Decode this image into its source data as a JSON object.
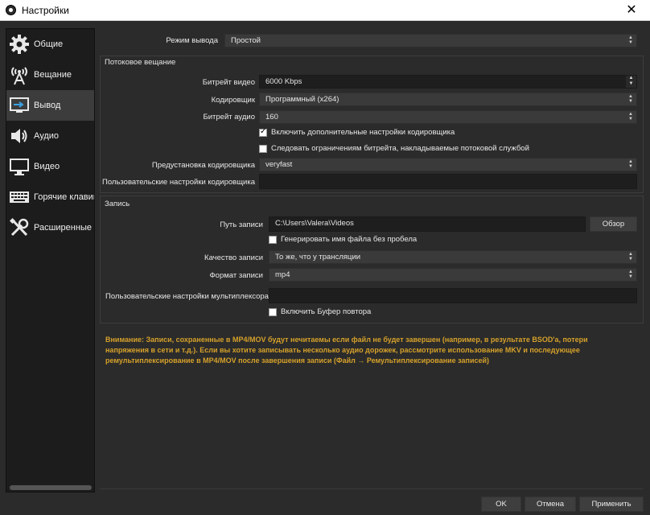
{
  "window": {
    "title": "Настройки",
    "close_glyph": "✕"
  },
  "sidebar": {
    "items": [
      {
        "label": "Общие",
        "icon": "gear-icon"
      },
      {
        "label": "Вещание",
        "icon": "broadcast-antenna-icon"
      },
      {
        "label": "Вывод",
        "icon": "output-monitor-icon",
        "active": true
      },
      {
        "label": "Аудио",
        "icon": "speaker-icon"
      },
      {
        "label": "Видео",
        "icon": "monitor-icon"
      },
      {
        "label": "Горячие клавиши",
        "icon": "keyboard-icon"
      },
      {
        "label": "Расширенные",
        "icon": "tools-icon"
      }
    ]
  },
  "output_mode": {
    "label": "Режим вывода",
    "value": "Простой"
  },
  "streaming": {
    "title": "Потоковое вещание",
    "video_bitrate_label": "Битрейт видео",
    "video_bitrate_value": "6000 Kbps",
    "encoder_label": "Кодировщик",
    "encoder_value": "Программный (x264)",
    "audio_bitrate_label": "Битрейт аудио",
    "audio_bitrate_value": "160",
    "advanced_encoder_checkbox": "Включить дополнительные настройки кодировщика",
    "advanced_encoder_checked": true,
    "enforce_bitrate_checkbox": "Следовать ограничениям битрейта, накладываемые потоковой службой",
    "enforce_bitrate_checked": false,
    "preset_label": "Предустановка кодировщика",
    "preset_value": "veryfast",
    "custom_encoder_label": "Пользовательские настройки кодировщика",
    "custom_encoder_value": ""
  },
  "recording": {
    "title": "Запись",
    "path_label": "Путь записи",
    "path_value": "C:\\Users\\Valera\\Videos",
    "browse_label": "Обзор",
    "no_space_checkbox": "Генерировать имя файла без пробела",
    "no_space_checked": false,
    "quality_label": "Качество записи",
    "quality_value": "То же, что у трансляции",
    "format_label": "Формат записи",
    "format_value": "mp4",
    "muxer_label": "Пользовательские настройки мультиплексора",
    "muxer_value": "",
    "replay_buffer_checkbox": "Включить Буфер повтора",
    "replay_buffer_checked": false
  },
  "warning": "Внимание: Записи, сохраненные в MP4/MOV будут нечитаемы если файл не будет завершен (например, в результате BSOD'а, потери напряжения в сети и т.д.). Если вы хотите записывать несколько аудио дорожек, рассмотрите использование MKV и последующее ремультиплексирование в MP4/MOV после завершения записи (Файл → Ремультиплексирование записей)",
  "buttons": {
    "ok": "OK",
    "cancel": "Отмена",
    "apply": "Применить"
  },
  "colors": {
    "background": "#2b2b2b",
    "sidebar": "#1c1c1c",
    "warning": "#d6a12a"
  }
}
